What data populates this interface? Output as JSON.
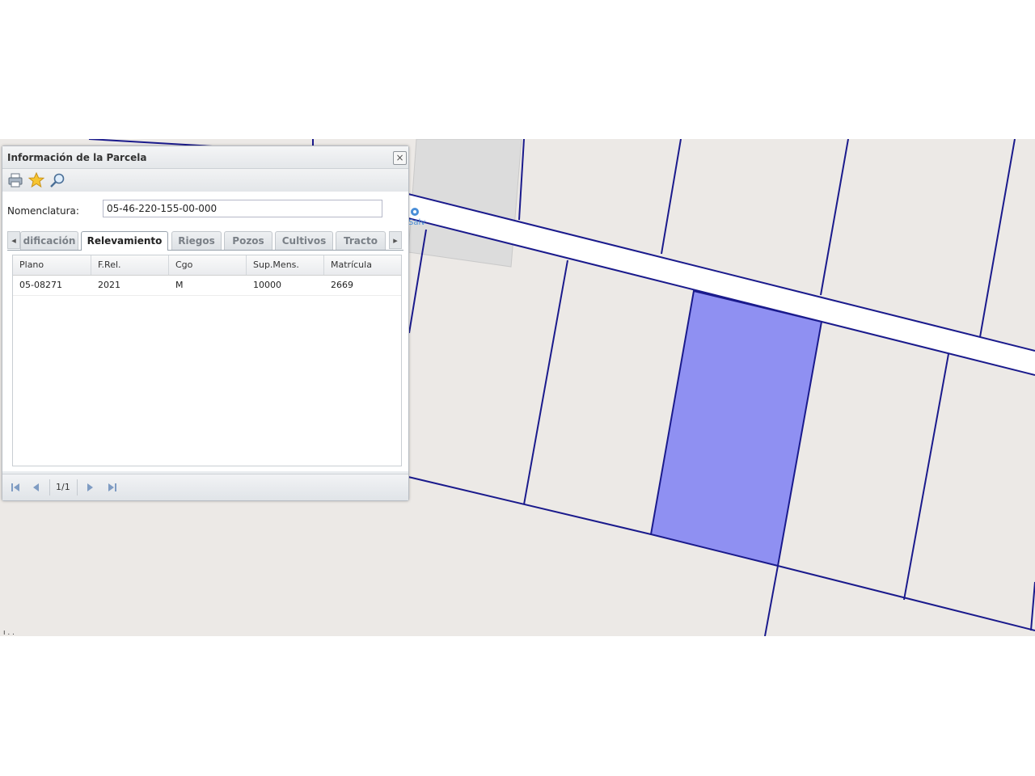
{
  "panel": {
    "title": "Información de la Parcela",
    "close_label": "×"
  },
  "toolbar": {
    "icons": [
      "printer-icon",
      "star-icon",
      "magnifier-icon"
    ]
  },
  "form": {
    "nomenclatura_label": "Nomenclatura:",
    "nomenclatura_value": "05-46-220-155-00-000"
  },
  "tabs": [
    {
      "label": "dificación",
      "active": false
    },
    {
      "label": "Relevamiento",
      "active": true
    },
    {
      "label": "Riegos",
      "active": false
    },
    {
      "label": "Pozos",
      "active": false
    },
    {
      "label": "Cultivos",
      "active": false
    },
    {
      "label": "Tracto",
      "active": false
    }
  ],
  "tab_scroll": {
    "left": "◂",
    "right": "▸"
  },
  "grid": {
    "columns": [
      "Plano",
      "F.Rel.",
      "Cgo",
      "Sup.Mens.",
      "Matrícula"
    ],
    "rows": [
      [
        "05-08271",
        "2021",
        "M",
        "10000",
        "2669"
      ]
    ]
  },
  "pager": {
    "page_text": "1/1"
  },
  "map": {
    "label": "Salv",
    "corner_text": "ı . .",
    "parcel_line_color": "#1a1a8c",
    "highlight_color": "#8f90f2",
    "road_color": "#ffffff"
  }
}
